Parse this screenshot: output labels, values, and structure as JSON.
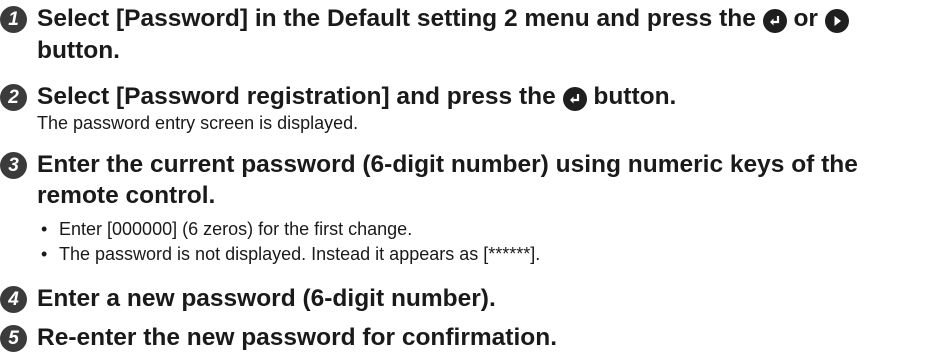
{
  "steps": [
    {
      "num": "1",
      "line1": "Select [Password] in the Default setting 2 menu and press the",
      "line1_or": "or",
      "line2": "button."
    },
    {
      "num": "2",
      "title_a": "Select [Password registration] and press the",
      "title_b": "button.",
      "body": "The password entry screen is displayed."
    },
    {
      "num": "3",
      "line1": "Enter the current password (6-digit number) using numeric keys of the",
      "line2": "remote control.",
      "bullets": [
        "Enter [000000] (6 zeros) for the first change.",
        "The password is not displayed. Instead it appears as [******]."
      ]
    },
    {
      "num": "4",
      "title": "Enter a new password (6-digit number)."
    },
    {
      "num": "5",
      "title": "Re-enter the new password for confirmation."
    }
  ],
  "icons": [
    "enter-button-icon",
    "right-arrow-button-icon"
  ]
}
